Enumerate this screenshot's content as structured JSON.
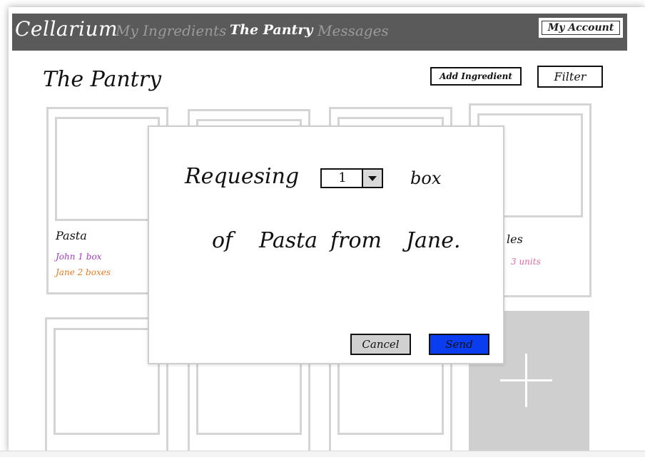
{
  "navbar": {
    "brand": "Cellarium",
    "links": [
      "My Ingredients",
      "The Pantry",
      "Messages"
    ],
    "account": "My Account"
  },
  "page": {
    "title": "The Pantry",
    "add_button": "Add Ingredient",
    "filter_button": "Filter"
  },
  "cards": [
    {
      "name": "Pasta",
      "holders": [
        {
          "text": "John  1 box",
          "color": "#a23bc0"
        },
        {
          "text": "Jane  2 boxes",
          "color": "#e87a22"
        }
      ]
    },
    {
      "name": "",
      "holders": []
    },
    {
      "name": "",
      "holders": []
    },
    {
      "name": "les",
      "holders": [
        {
          "text": "3 units",
          "color": "#e06aa0"
        }
      ]
    }
  ],
  "modal": {
    "word1": "Requesing",
    "quantity": "1",
    "unit": "box",
    "word_of": "of",
    "item": "Pasta",
    "word_from": "from",
    "owner": "Jane.",
    "cancel": "Cancel",
    "send": "Send"
  },
  "colors": {
    "nav_bg": "#5a5a5a",
    "send_bg": "#0a3cf0",
    "card_border": "#d4d4d4"
  }
}
